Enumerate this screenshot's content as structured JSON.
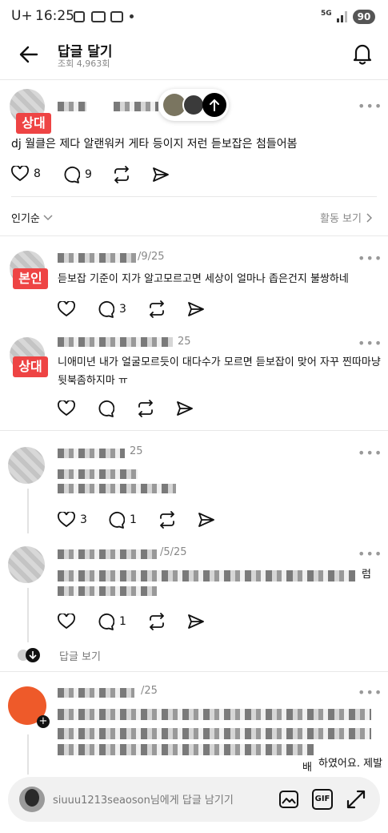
{
  "status_bar": {
    "carrier": "U+",
    "time": "16:25",
    "network": "5G",
    "battery": "90"
  },
  "header": {
    "title": "답글 달기",
    "views": "조회 4,963회"
  },
  "main_post": {
    "tag": "상대",
    "text": "dj 월클은 제다 알랜워커 게타 등이지 저런 듣보잡은 첨들어봄",
    "likes": "8",
    "comments": "9"
  },
  "sort_bar": {
    "sort_label": "인기순",
    "activity_label": "활동 보기"
  },
  "replies": [
    {
      "tag": "본인",
      "date": "/9/25",
      "text": "듣보잡 기준이 지가 알고모르고면 세상이 얼마나 좁은건지 불쌍하네",
      "comments": "3"
    },
    {
      "tag": "상대",
      "date": "25",
      "text_line1": "니애미년 내가 얼굴모르듯이 대다수가 모르면 듣보잡이 맞어 자꾸 찐따마냥",
      "text_line2": "뒷북좀하지마 ㅠ"
    },
    {
      "date": "25",
      "likes": "3",
      "comments": "1"
    },
    {
      "date": "/5/25",
      "text_fragment": "럼",
      "comments": "1"
    },
    {
      "date": "/25",
      "text_fragment1": "하였어요. 제발",
      "text_fragment2": "배"
    }
  ],
  "view_replies": "답글 보기",
  "reply_input": {
    "placeholder": "siuuu1213seaoson님에게 답글 남기기",
    "gif_label": "GIF"
  }
}
